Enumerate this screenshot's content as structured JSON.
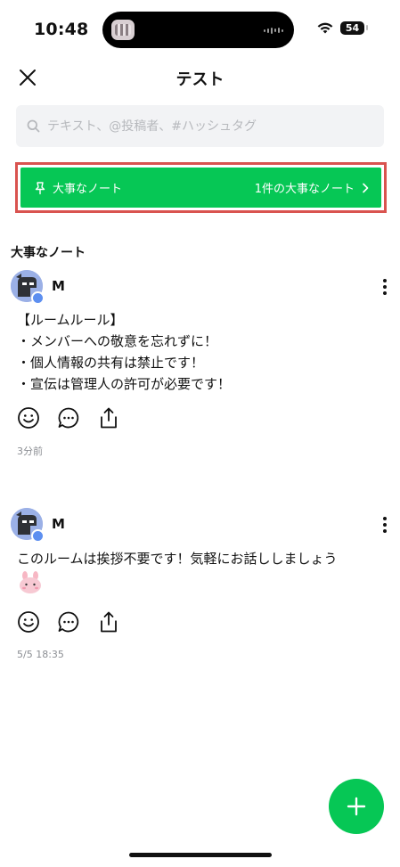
{
  "status_bar": {
    "time": "10:48",
    "battery": "54"
  },
  "header": {
    "title": "テスト"
  },
  "search": {
    "placeholder": "テキスト、@投稿者、#ハッシュタグ"
  },
  "banner": {
    "label": "大事なノート",
    "count_label": "1件の大事なノート"
  },
  "section": {
    "title": "大事なノート"
  },
  "posts": [
    {
      "author": "M",
      "lines": [
        "【ルームルール】",
        "・メンバーへの敬意を忘れずに！",
        "・個人情報の共有は禁止です！",
        "・宣伝は管理人の許可が必要です！"
      ],
      "time": "3分前"
    },
    {
      "author": "M",
      "lines": [
        "このルームは挨拶不要です！気軽にお話ししましょう"
      ],
      "time": "5/5 18:35"
    }
  ],
  "colors": {
    "accent": "#06c755",
    "highlight_border": "#d9534f"
  }
}
